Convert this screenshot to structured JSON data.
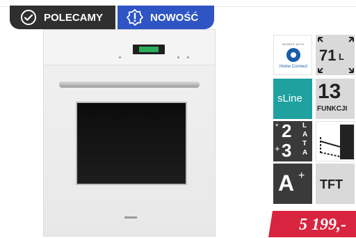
{
  "badges": {
    "recommended": {
      "label": "POLECAMY",
      "icon": "check-circle-icon",
      "color": "#2f2f2f"
    },
    "new": {
      "label": "NOWOŚĆ",
      "icon": "exclamation-badge-icon",
      "color": "#2f55c5"
    }
  },
  "features": {
    "home_connect": {
      "top": "WORKS WITH",
      "name": "Home Connect",
      "icon": "home-connect-icon"
    },
    "capacity": {
      "value": "71",
      "unit": "L",
      "icon": "expand-arrows-icon"
    },
    "series": {
      "label": "sLine"
    },
    "functions": {
      "value": "13",
      "label": "FUNKCJI"
    },
    "warranty": {
      "star": "*",
      "value1": "2",
      "value2": "3",
      "plus": "+",
      "letters": [
        "L",
        "A",
        "T",
        "A"
      ]
    },
    "rails": {
      "icon": "telescopic-rails-icon"
    },
    "energy": {
      "class": "A",
      "plus": "+"
    },
    "display": {
      "label": "TFT"
    }
  },
  "price": {
    "value": "5 199,-",
    "color": "#d9243f"
  }
}
